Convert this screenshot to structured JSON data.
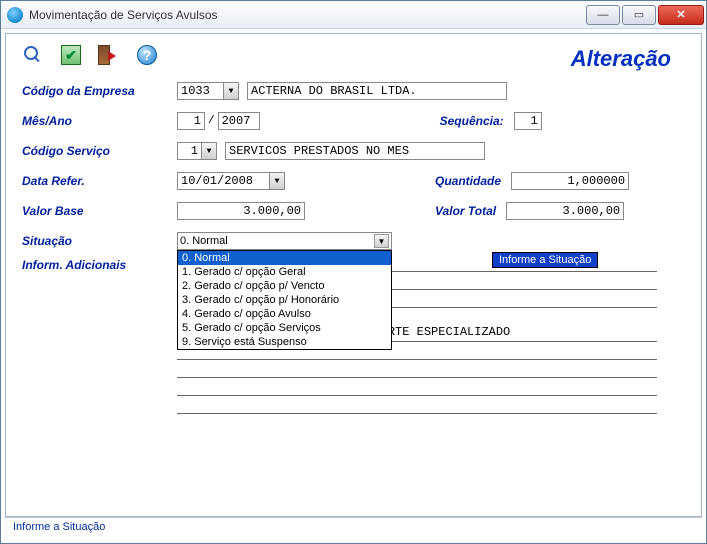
{
  "window": {
    "title": "Movimentação de Serviços Avulsos"
  },
  "header": {
    "mode": "Alteração"
  },
  "toolbar": {
    "search": "search",
    "confirm": "confirm",
    "exit": "exit",
    "help": "help"
  },
  "labels": {
    "codigo_empresa": "Código da Empresa",
    "mes_ano": "Mês/Ano",
    "sequencia": "Sequência:",
    "codigo_servico": "Código Serviço",
    "data_refer": "Data Refer.",
    "quantidade": "Quantidade",
    "valor_base": "Valor Base",
    "valor_total": "Valor Total",
    "situacao": "Situação",
    "inform_adicionais": "Inform. Adicionais"
  },
  "fields": {
    "codigo_empresa": "1033",
    "empresa_nome": "ACTERNA DO BRASIL LTDA.",
    "mes": "1",
    "ano": "2007",
    "sequencia": "1",
    "codigo_servico": "1",
    "servico_nome": "SERVICOS PRESTADOS NO MES",
    "data_refer": "10/01/2008",
    "quantidade": "1,000000",
    "valor_base": "3.000,00",
    "valor_total": "3.000,00",
    "situacao_selected": "0. Normal",
    "info_linhas": [
      "",
      "",
      ""
    ],
    "info_linhas2": [
      "SERVICO DE CONSULTORIA E SUPORTE ESPECIALIZADO",
      "",
      "",
      "",
      ""
    ]
  },
  "situacao_options": [
    "0. Normal",
    "1. Gerado c/ opção Geral",
    "2. Gerado c/ opção p/ Vencto",
    "3. Gerado c/ opção p/ Honorário",
    "4. Gerado c/ opção Avulso",
    "5. Gerado c/ opção Serviços",
    "9. Serviço está Suspenso"
  ],
  "hint": "Informe a Situação",
  "statusbar": "Informe a Situação",
  "mes_ano_sep": "/"
}
